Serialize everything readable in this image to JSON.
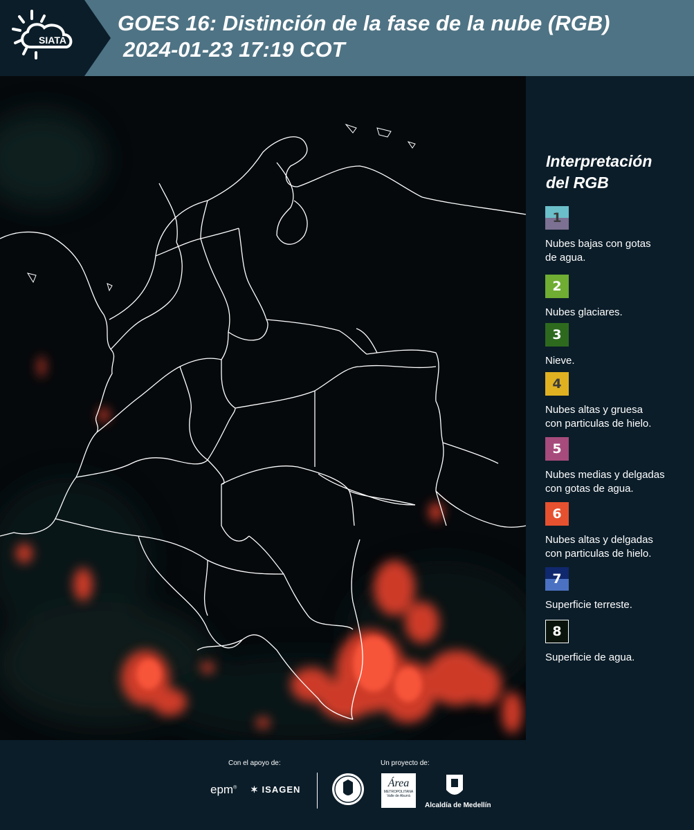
{
  "header": {
    "logo_text": "SIATA",
    "title_line1": "GOES 16: Distinción de la fase de la nube (RGB)",
    "title_line2": "2024-01-23 17:19 COT",
    "bg_color": "#4e7384"
  },
  "legend": {
    "title_line1": "Interpretación",
    "title_line2": "del RGB",
    "items": [
      {
        "num": "1",
        "label_line1": "Nubes bajas con gotas",
        "label_line2": "de agua.",
        "colors": [
          "#6bbfc9",
          "#7c7192"
        ]
      },
      {
        "num": "2",
        "label_line1": "Nubes glaciares.",
        "label_line2": "",
        "colors": [
          "#6fad33"
        ]
      },
      {
        "num": "3",
        "label_line1": "Nieve.",
        "label_line2": "",
        "colors": [
          "#2d6a1e"
        ]
      },
      {
        "num": "4",
        "label_line1": "Nubes altas y gruesa",
        "label_line2": "con particulas de hielo.",
        "colors": [
          "#e0b221"
        ]
      },
      {
        "num": "5",
        "label_line1": "Nubes medias y delgadas",
        "label_line2": "con gotas de agua.",
        "colors": [
          "#a64b7c"
        ]
      },
      {
        "num": "6",
        "label_line1": "Nubes altas y delgadas",
        "label_line2": "con particulas de hielo.",
        "colors": [
          "#e6512f"
        ]
      },
      {
        "num": "7",
        "label_line1": "Superficie terreste.",
        "label_line2": "",
        "colors": [
          "#10286e",
          "#4b72c2"
        ]
      },
      {
        "num": "8",
        "label_line1": "Superficie de agua.",
        "label_line2": "",
        "colors": [
          "#0a140c"
        ]
      }
    ]
  },
  "footer": {
    "support_label": "Con el apoyo de:",
    "project_label": "Un proyecto de:",
    "sponsor_epm": "epm",
    "sponsor_isagen": "ISAGEN",
    "partner_area_line1": "Área",
    "partner_area_line2": "METROPOLITANA",
    "partner_area_line3": "Valle de Aburrá",
    "partner_medellin": "Alcaldía de Medellín"
  }
}
